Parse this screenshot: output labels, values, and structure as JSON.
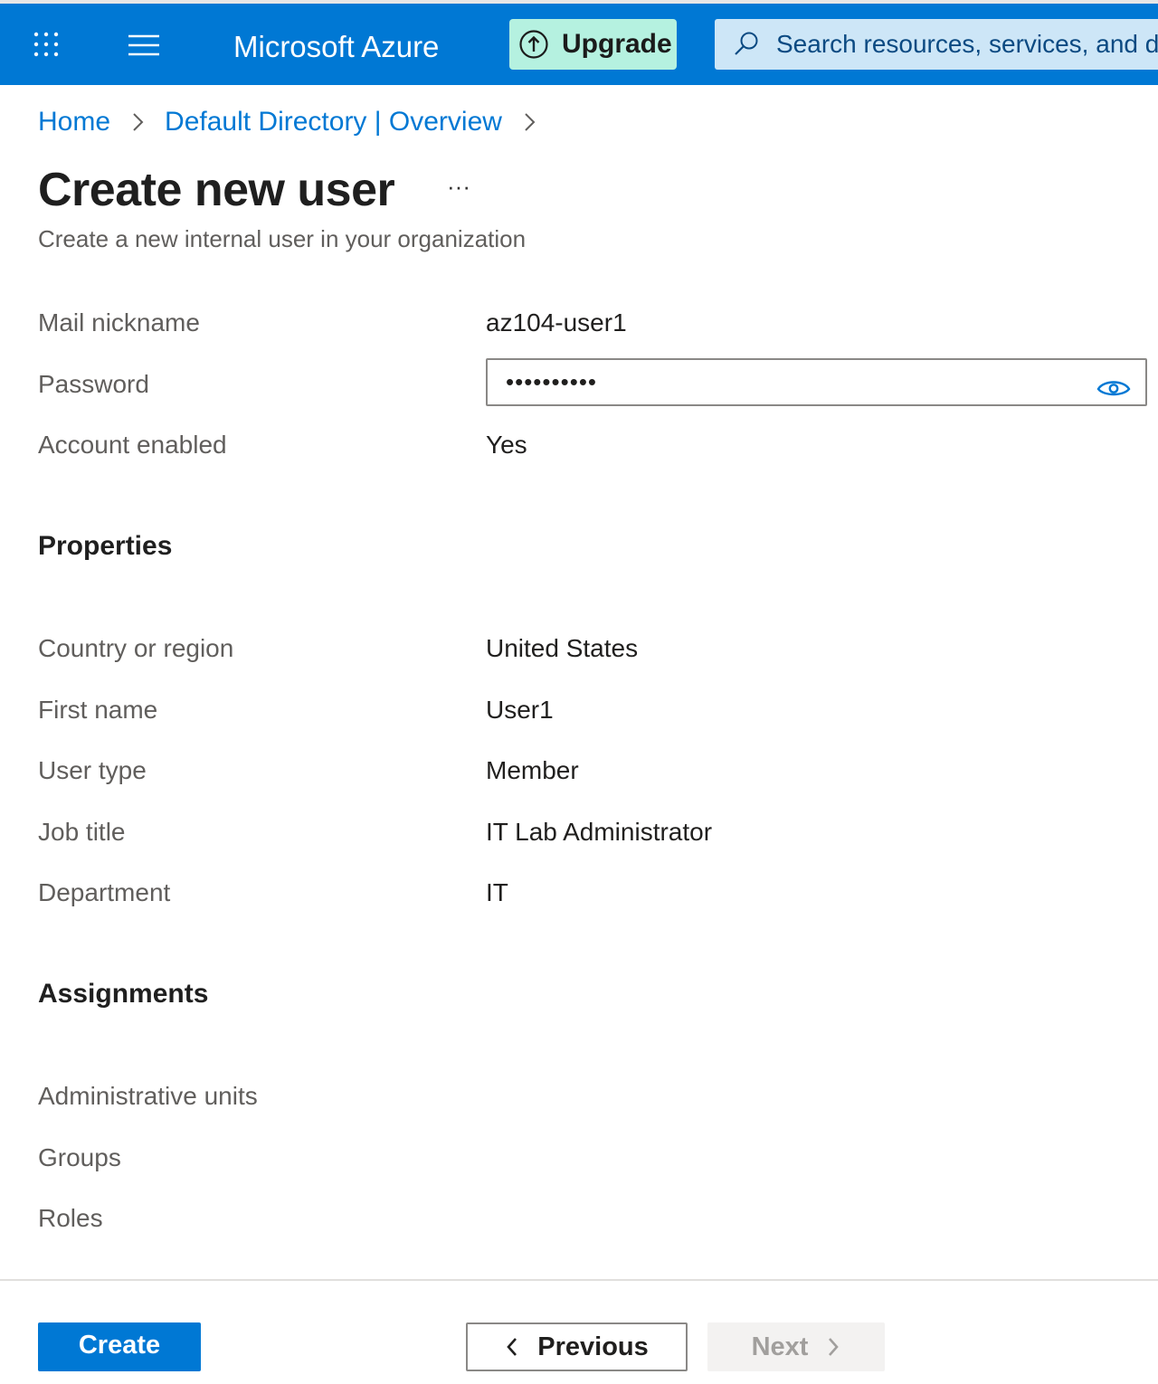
{
  "header": {
    "brand": "Microsoft Azure",
    "upgrade_label": "Upgrade",
    "search_placeholder": "Search resources, services, and docs (G+/)",
    "search_visible_text": "Search resources, services, and do"
  },
  "breadcrumb": {
    "items": [
      "Home",
      "Default Directory | Overview"
    ]
  },
  "page": {
    "title": "Create new user",
    "more_label": "···",
    "subtitle": "Create a new internal user in your organization"
  },
  "basics": {
    "mail_nickname": {
      "label": "Mail nickname",
      "value": "az104-user1"
    },
    "password": {
      "label": "Password",
      "value": "••••••••••"
    },
    "account_enabled": {
      "label": "Account enabled",
      "value": "Yes"
    }
  },
  "properties": {
    "heading": "Properties",
    "country": {
      "label": "Country or region",
      "value": "United States"
    },
    "first_name": {
      "label": "First name",
      "value": "User1"
    },
    "user_type": {
      "label": "User type",
      "value": "Member"
    },
    "job_title": {
      "label": "Job title",
      "value": "IT Lab Administrator"
    },
    "department": {
      "label": "Department",
      "value": "IT"
    }
  },
  "assignments": {
    "heading": "Assignments",
    "admin_units": {
      "label": "Administrative units"
    },
    "groups": {
      "label": "Groups"
    },
    "roles": {
      "label": "Roles"
    }
  },
  "footer": {
    "create_label": "Create",
    "previous_label": "Previous",
    "next_label": "Next"
  },
  "colors": {
    "accent": "#0078d4",
    "upgrade_bg": "#b5f1e0",
    "search_bg": "#cde6f7"
  },
  "icons": {
    "waffle": "waffle-icon",
    "menu": "hamburger-icon",
    "upgrade": "arrow-up-circle-icon",
    "search": "search-icon",
    "breadcrumb_sep": "chevron-right-icon",
    "password_reveal": "eye-icon",
    "previous": "chevron-left-icon",
    "next": "chevron-right-icon"
  }
}
